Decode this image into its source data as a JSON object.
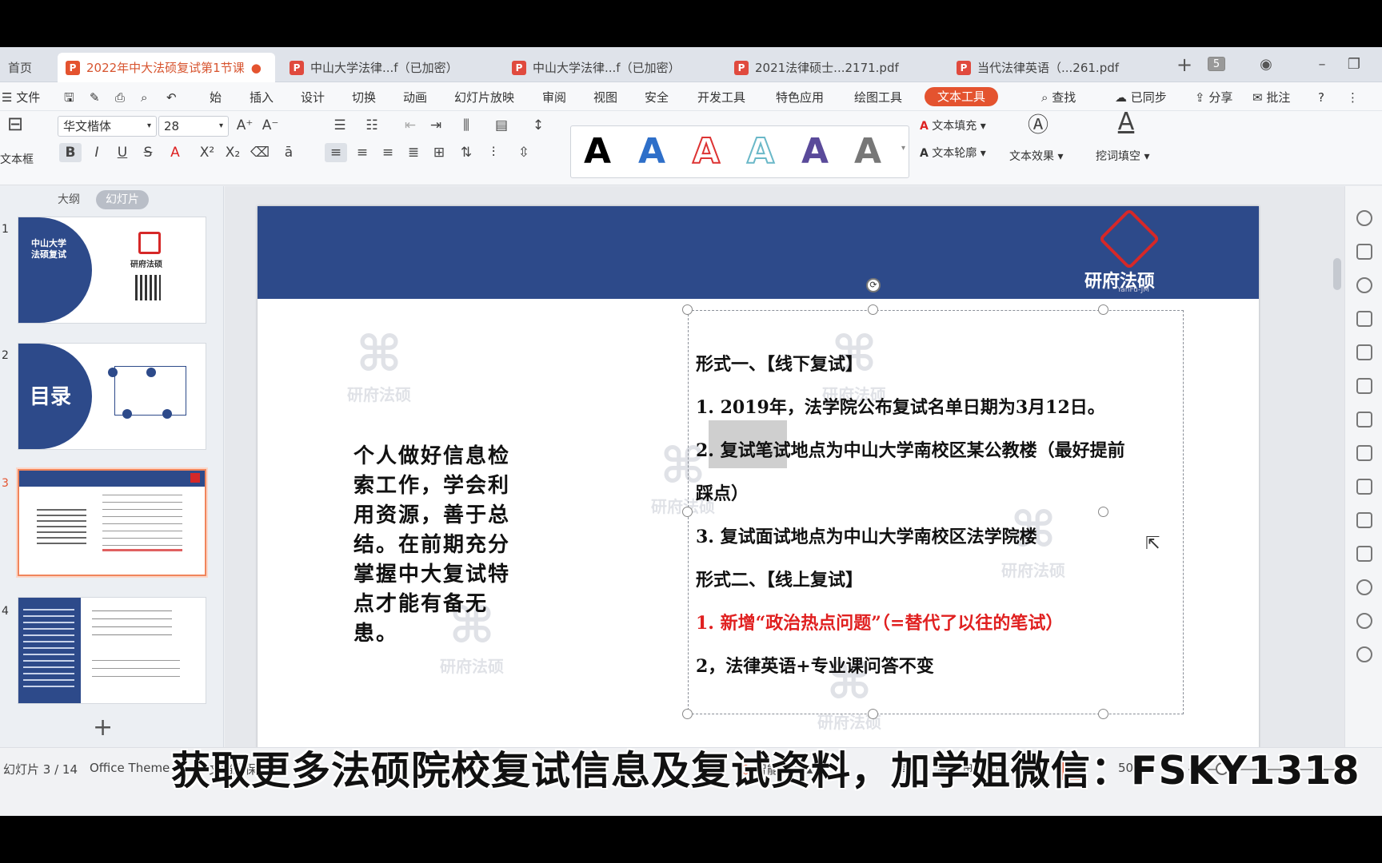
{
  "colors": {
    "accent": "#e4532f",
    "slide_header": "#2d4a8a",
    "red_text": "#e02020"
  },
  "tabs": [
    {
      "label": "首页"
    },
    {
      "label": "2022年中大法硕复试第1节课",
      "active": true
    },
    {
      "label": "中山大学法律...f（已加密）"
    },
    {
      "label": "中山大学法律...f（已加密）"
    },
    {
      "label": "2021法律硕士...2171.pdf"
    },
    {
      "label": "当代法律英语（...261.pdf"
    }
  ],
  "tab_tools": {
    "add": "+",
    "count": "5"
  },
  "menu": {
    "file": "文件",
    "items": [
      "始",
      "插入",
      "设计",
      "切换",
      "动画",
      "幻灯片放映",
      "审阅",
      "视图",
      "安全",
      "开发工具",
      "特色应用",
      "绘图工具",
      "文本工具"
    ],
    "search": "查找",
    "synced": "已同步",
    "share": "分享",
    "comment": "批注"
  },
  "ribbon": {
    "textbox": "文本框",
    "font_name": "华文楷体",
    "font_size": "28",
    "art_letter": "A",
    "text_fill": "文本填充",
    "text_outline": "文本轮廓",
    "text_effect": "文本效果",
    "cloze": "挖词填空"
  },
  "panel": {
    "outline_tab": "大纲",
    "slides_tab": "幻灯片",
    "thumbs": [
      {
        "num": "1",
        "title": "中山大学\n法硕复试",
        "brand": "研府法硕"
      },
      {
        "num": "2",
        "title": "目录"
      },
      {
        "num": "3"
      },
      {
        "num": "4"
      }
    ],
    "add": "+"
  },
  "slide": {
    "logo_text": "研府法硕",
    "logo_sub": "YanFu-JM",
    "left_text": "个人做好信息检索工作，学会利用资源，善于总结。在前期充分掌握中大复试特点才能有备无患。",
    "lines": [
      "形式一、【线下复试】",
      "1. 2019年，法学院公布复试名单日期为3月12日。",
      "2. 复试笔试地点为中山大学南校区某公教楼（最好提前",
      "踩点）",
      "3. 复试面试地点为中山大学南校区法学院楼",
      "形式二、【线上复试】",
      "1. 新增“政治热点问题”（=替代了以往的笔试）",
      "2，法律英语+专业课问答不变"
    ],
    "watermark_text": "研府法硕",
    "watermark_sub": "YanFu-JM"
  },
  "status": {
    "slide_info": "幻灯片 3 / 14",
    "theme": "Office Theme",
    "protect": "文档未保护",
    "smart": "智能排版",
    "zoom": "50%"
  },
  "banner": "获取更多法硕院校复试信息及复试资料，加学姐微信：FSKY1318"
}
